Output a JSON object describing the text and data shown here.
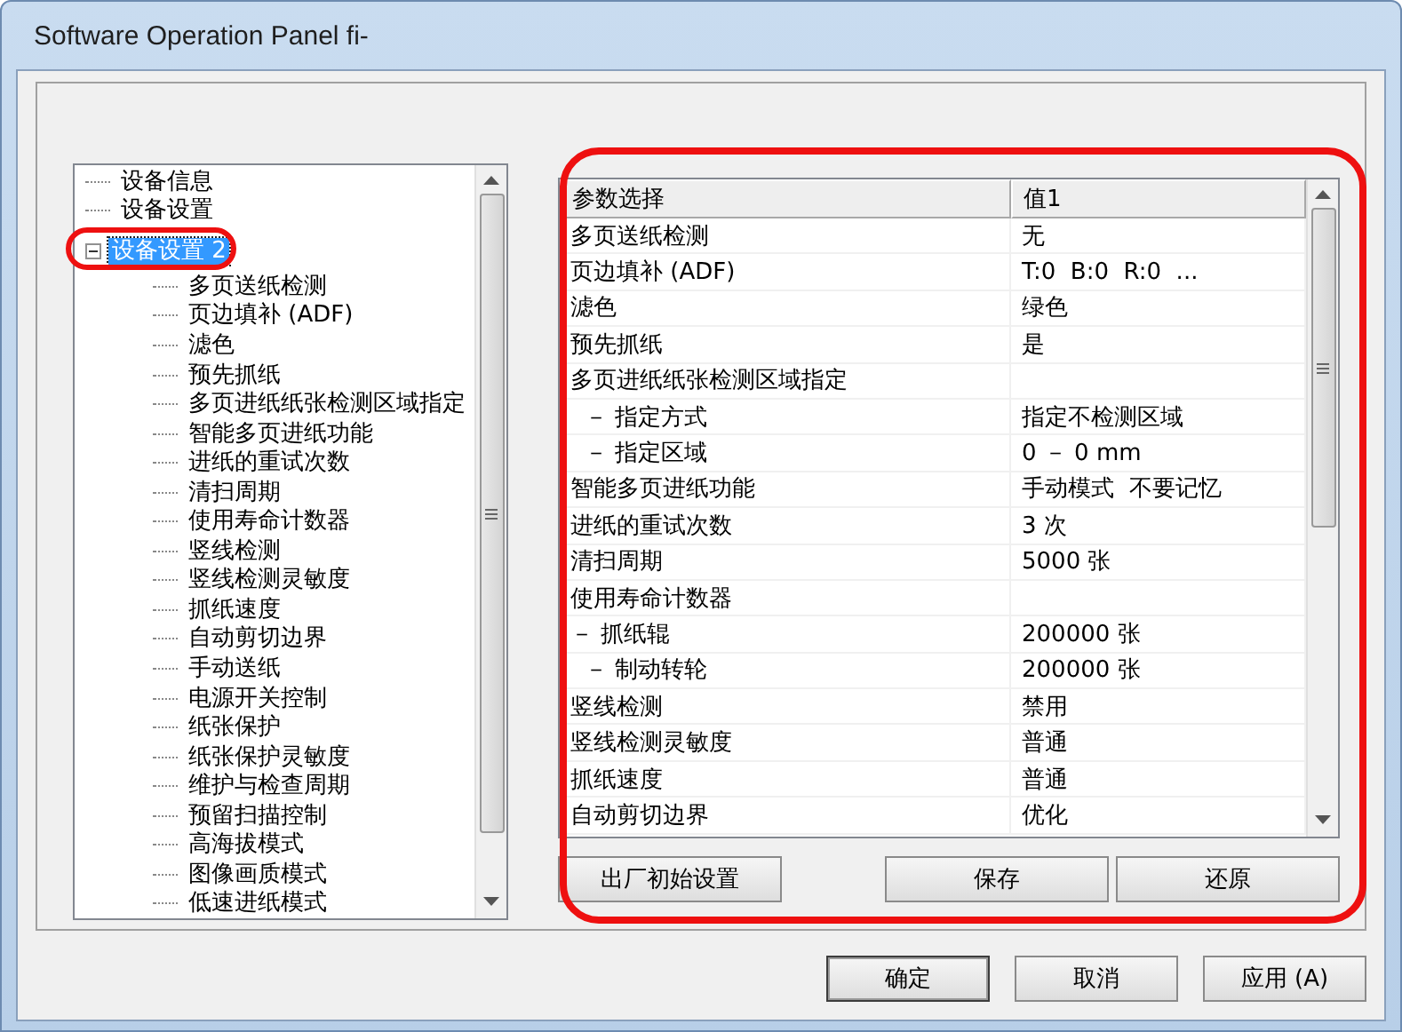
{
  "window": {
    "title": "Software Operation Panel fi-"
  },
  "tree": {
    "items": [
      {
        "label": "设备信息",
        "selected": false
      },
      {
        "label": "设备设置",
        "selected": false
      },
      {
        "label": "设备设置 2",
        "selected": true,
        "expanded": true,
        "children": [
          {
            "label": "多页送纸检测"
          },
          {
            "label": "页边填补 (ADF)"
          },
          {
            "label": "滤色"
          },
          {
            "label": "预先抓纸"
          },
          {
            "label": "多页进纸纸张检测区域指定"
          },
          {
            "label": "智能多页进纸功能"
          },
          {
            "label": "进纸的重试次数"
          },
          {
            "label": "清扫周期"
          },
          {
            "label": "使用寿命计数器"
          },
          {
            "label": "竖线检测"
          },
          {
            "label": "竖线检测灵敏度"
          },
          {
            "label": "抓纸速度"
          },
          {
            "label": "自动剪切边界"
          },
          {
            "label": "手动送纸"
          },
          {
            "label": "电源开关控制"
          },
          {
            "label": "纸张保护"
          },
          {
            "label": "纸张保护灵敏度"
          },
          {
            "label": "维护与检查周期"
          },
          {
            "label": "预留扫描控制"
          },
          {
            "label": "高海拔模式"
          },
          {
            "label": "图像画质模式"
          },
          {
            "label": "低速进纸模式"
          }
        ]
      }
    ]
  },
  "table": {
    "columns": [
      "参数选择",
      "值1"
    ],
    "rows": [
      {
        "parameter": "多页送纸检测",
        "value": "无",
        "indented": false
      },
      {
        "parameter": "页边填补 (ADF)",
        "value": "T:0  B:0  R:0  ...",
        "indented": false
      },
      {
        "parameter": "滤色",
        "value": "绿色",
        "indented": false
      },
      {
        "parameter": "预先抓纸",
        "value": "是",
        "indented": false
      },
      {
        "parameter": "多页进纸纸张检测区域指定",
        "indented": false
      },
      {
        "parameter": "－ 指定方式",
        "value": "指定不检测区域",
        "indented": true
      },
      {
        "parameter": "－ 指定区域",
        "value": "0 － 0 mm",
        "indented": true
      },
      {
        "parameter": "智能多页进纸功能",
        "value": "手动模式  不要记忆",
        "indented": false
      },
      {
        "parameter": "进纸的重试次数",
        "value": "3 次",
        "indented": false
      },
      {
        "parameter": "清扫周期",
        "value": "5000 张",
        "indented": false
      },
      {
        "parameter": "使用寿命计数器",
        "indented": false
      },
      {
        "parameter": "－ 抓纸辊",
        "value": "200000 张",
        "indented": false
      },
      {
        "parameter": "－ 制动转轮",
        "value": "200000 张",
        "indented": true
      },
      {
        "parameter": "竖线检测",
        "value": "禁用",
        "indented": false
      },
      {
        "parameter": "竖线检测灵敏度",
        "value": "普通",
        "indented": false
      },
      {
        "parameter": "抓纸速度",
        "value": "普通",
        "indented": false
      },
      {
        "parameter": "自动剪切边界",
        "value": "优化",
        "indented": false
      }
    ]
  },
  "panel_buttons": [
    "出厂初始设置",
    "保存",
    "还原"
  ],
  "dialog_buttons": [
    {
      "label": "确定",
      "default": true
    },
    {
      "label": "取消",
      "default": false
    },
    {
      "label": "应用 (A)",
      "default": false
    }
  ]
}
